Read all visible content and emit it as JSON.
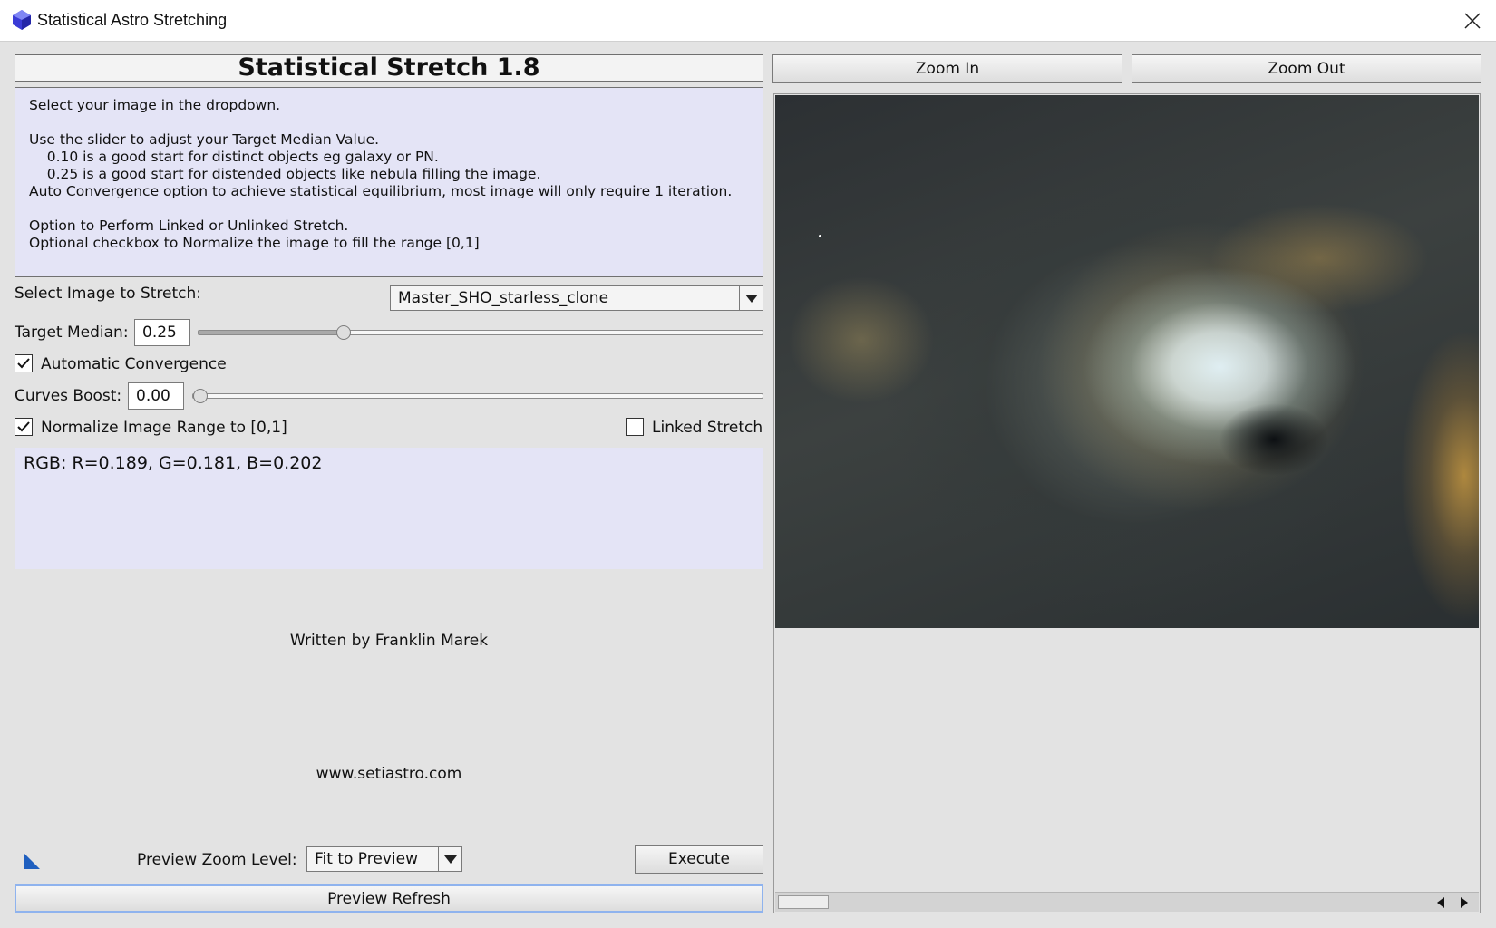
{
  "window": {
    "title": "Statistical Astro Stretching"
  },
  "header": {
    "title": "Statistical Stretch 1.8"
  },
  "instructions": {
    "text": "Select your image in the dropdown.\n\nUse the slider to adjust your Target Median Value.\n    0.10 is a good start for distinct objects eg galaxy or PN.\n    0.25 is a good start for distended objects like nebula filling the image.\nAuto Convergence option to achieve statistical equilibrium, most image will only require 1 iteration.\n\nOption to Perform Linked or Unlinked Stretch.\nOptional checkbox to Normalize the image to fill the range [0,1]"
  },
  "image_select": {
    "label": "Select Image to Stretch:",
    "value": "Master_SHO_starless_clone"
  },
  "target_median": {
    "label": "Target Median:",
    "value": "0.25",
    "slider_fraction": 0.25
  },
  "auto_convergence": {
    "label": "Automatic Convergence",
    "checked": true
  },
  "curves_boost": {
    "label": "Curves Boost:",
    "value": "0.00",
    "slider_fraction": 0.0
  },
  "normalize": {
    "label": "Normalize Image Range to [0,1]",
    "checked": true
  },
  "linked_stretch": {
    "label": "Linked Stretch",
    "checked": false
  },
  "readout": {
    "text": "RGB: R=0.189, G=0.181, B=0.202"
  },
  "credits": {
    "author": "Written by Franklin Marek",
    "website": "www.setiastro.com"
  },
  "preview_zoom": {
    "label": "Preview Zoom Level:",
    "value": "Fit to Preview"
  },
  "buttons": {
    "execute": "Execute",
    "preview_refresh": "Preview Refresh",
    "zoom_in": "Zoom In",
    "zoom_out": "Zoom Out"
  },
  "colors": {
    "panel_background": "#e3e3e3",
    "instruction_background": "#e4e4f6",
    "accent_blue": "#1f5fbf"
  }
}
